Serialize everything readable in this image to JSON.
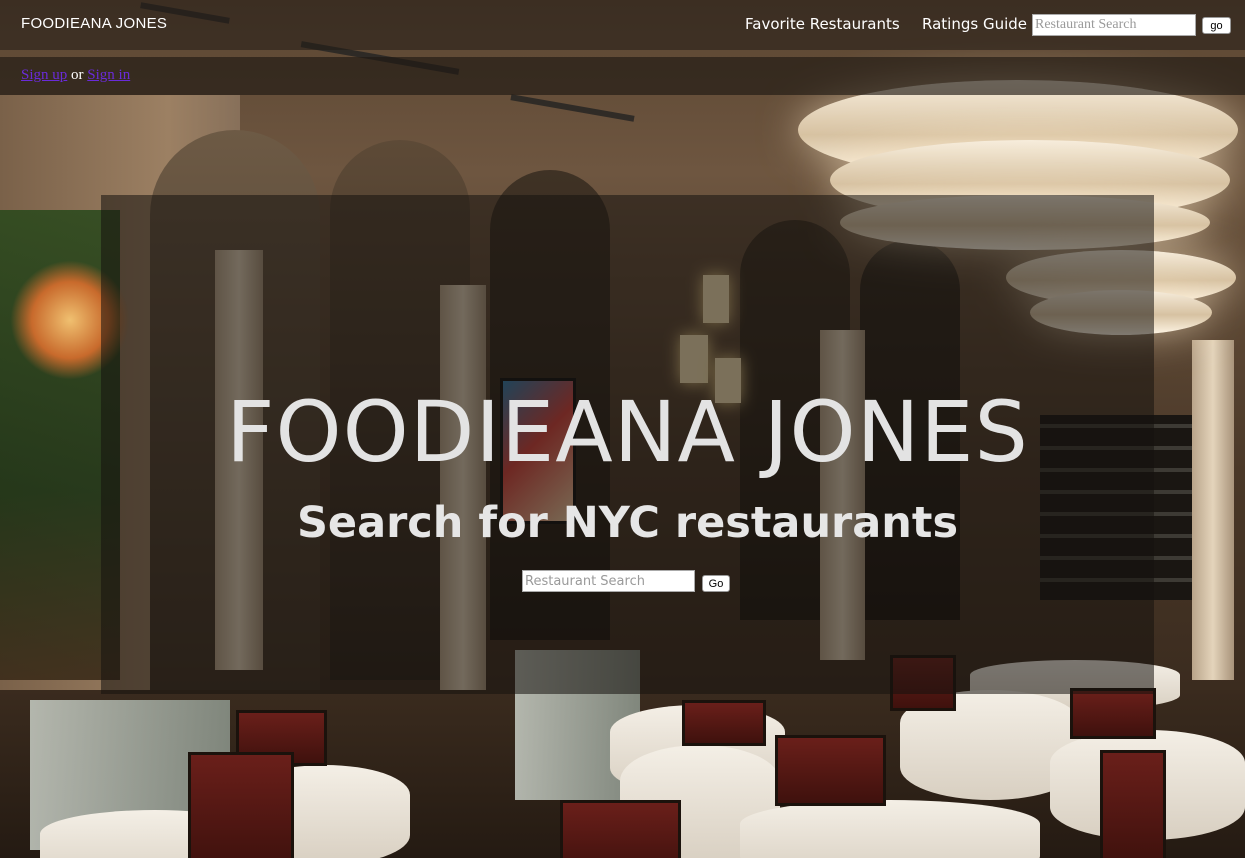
{
  "header": {
    "brand": "FOODIEANA JONES",
    "nav": {
      "favorite_restaurants": "Favorite Restaurants",
      "ratings_guide": "Ratings Guide"
    },
    "search": {
      "placeholder": "Restaurant Search",
      "value": "",
      "go_label": "go"
    }
  },
  "auth": {
    "sign_up": "Sign up",
    "or": " or ",
    "sign_in": "Sign in"
  },
  "hero": {
    "title": "FOODIEANA JONES",
    "subtitle": "Search for NYC restaurants",
    "search": {
      "placeholder": "Restaurant Search",
      "value": "",
      "go_label": "Go"
    }
  },
  "colors": {
    "link_visited": "#6a2bd9",
    "hero_text": "#e3e3e3",
    "nav_text": "#ffffff"
  }
}
